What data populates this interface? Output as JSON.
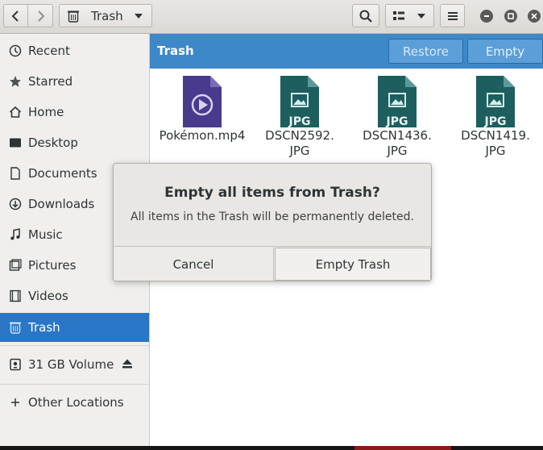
{
  "header": {
    "path_label": "Trash"
  },
  "sidebar": {
    "items": [
      {
        "label": "Recent",
        "icon": "clock-icon"
      },
      {
        "label": "Starred",
        "icon": "star-icon"
      },
      {
        "label": "Home",
        "icon": "home-icon"
      },
      {
        "label": "Desktop",
        "icon": "desktop-icon"
      },
      {
        "label": "Documents",
        "icon": "document-icon"
      },
      {
        "label": "Downloads",
        "icon": "download-icon"
      },
      {
        "label": "Music",
        "icon": "music-icon"
      },
      {
        "label": "Pictures",
        "icon": "pictures-icon"
      },
      {
        "label": "Videos",
        "icon": "videos-icon"
      },
      {
        "label": "Trash",
        "icon": "trash-icon",
        "active": true
      },
      {
        "label": "31 GB Volume",
        "icon": "drive-icon"
      },
      {
        "label": "Other Locations",
        "icon": "plus-icon"
      }
    ]
  },
  "action_bar": {
    "title": "Trash",
    "restore_label": "Restore",
    "empty_label": "Empty"
  },
  "files": [
    {
      "name": "Pokémon.mp4",
      "type": "video"
    },
    {
      "name": "DSCN2592.\nJPG",
      "type": "jpg",
      "badge": "JPG"
    },
    {
      "name": "DSCN1436.\nJPG",
      "type": "jpg",
      "badge": "JPG"
    },
    {
      "name": "DSCN1419.\nJPG",
      "type": "jpg",
      "badge": "JPG"
    }
  ],
  "dialog": {
    "title": "Empty all items from Trash?",
    "message": "All items in the Trash will be permanently deleted.",
    "cancel_label": "Cancel",
    "confirm_label": "Empty Trash"
  },
  "colors": {
    "accent": "#2a76c6",
    "action_bar": "#3d88c9",
    "video_file": "#4a3a8c",
    "image_file": "#1d5e5e"
  }
}
